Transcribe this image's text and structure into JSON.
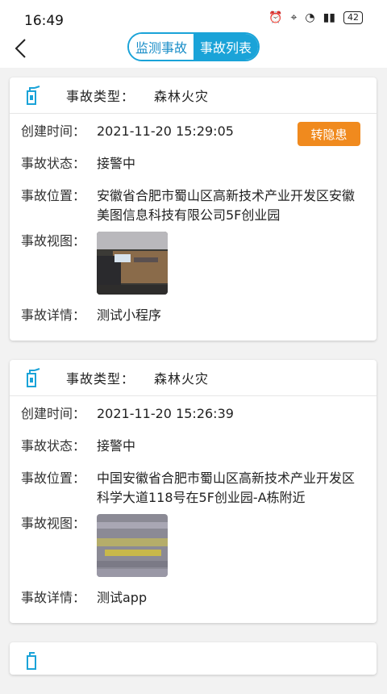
{
  "status_bar": {
    "time": "16:49",
    "battery": "42"
  },
  "nav": {
    "tabs": [
      {
        "label": "监测事故"
      },
      {
        "label": "事故列表"
      }
    ]
  },
  "cards": [
    {
      "type_label": "事故类型：",
      "type_value": "森林火灾",
      "created_label": "创建时间：",
      "created_value": "2021-11-20 15:29:05",
      "status_label": "事故状态：",
      "status_value": "接警中",
      "location_label": "事故位置：",
      "location_value": "安徽省合肥市蜀山区高新技术产业开发区安徽美图信息科技有限公司5F创业园",
      "view_label": "事故视图：",
      "detail_label": "事故详情：",
      "detail_value": "测试小程序",
      "action_button": "转隐患"
    },
    {
      "type_label": "事故类型：",
      "type_value": "森林火灾",
      "created_label": "创建时间：",
      "created_value": "2021-11-20 15:26:39",
      "status_label": "事故状态：",
      "status_value": "接警中",
      "location_label": "事故位置：",
      "location_value": "中国安徽省合肥市蜀山区高新技术产业开发区科学大道118号在5F创业园-A栋附近",
      "view_label": "事故视图：",
      "detail_label": "事故详情：",
      "detail_value": "测试app"
    }
  ]
}
